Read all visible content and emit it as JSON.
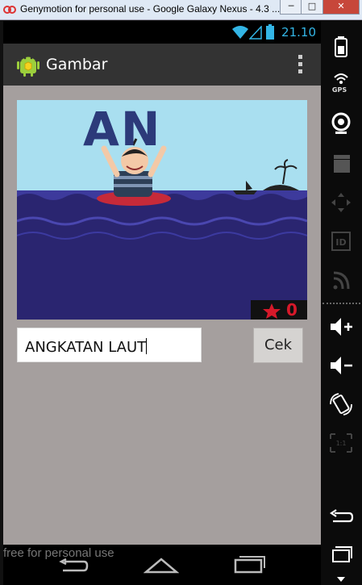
{
  "window": {
    "title": "Genymotion for personal use - Google Galaxy Nexus - 4.3 ...",
    "minimize_label": "─",
    "maximize_label": "□",
    "close_label": "✕"
  },
  "status_bar": {
    "time": "21.10",
    "icons": [
      "wifi-icon",
      "signal-icon",
      "battery-icon"
    ]
  },
  "action_bar": {
    "title": "Gambar",
    "icon": "android-icon",
    "overflow_icon": "overflow-menu-icon"
  },
  "puzzle": {
    "image_text": "AN",
    "score": "0",
    "score_icon": "star-icon"
  },
  "answer_input": {
    "value": "ANGKATAN LAUT"
  },
  "check_button": {
    "label": "Cek"
  },
  "navigation": {
    "items": [
      "back-icon",
      "home-icon",
      "recents-icon"
    ]
  },
  "watermark": "free for personal use",
  "side_panel": {
    "gps_label": "GPS",
    "buttons": [
      "battery-icon",
      "gps-icon",
      "camera-icon",
      "video-capture-icon",
      "dpad-icon",
      "device-id-icon",
      "network-icon",
      "volume-up-icon",
      "volume-down-icon",
      "rotate-icon",
      "scale-icon",
      "back-icon",
      "menu-icon",
      "more-icon"
    ]
  },
  "colors": {
    "accent": "#33b5e5",
    "action_bar": "#333333",
    "content_background": "#a59f9e",
    "sea": "#2a2570",
    "sky": "#a9dff0"
  }
}
